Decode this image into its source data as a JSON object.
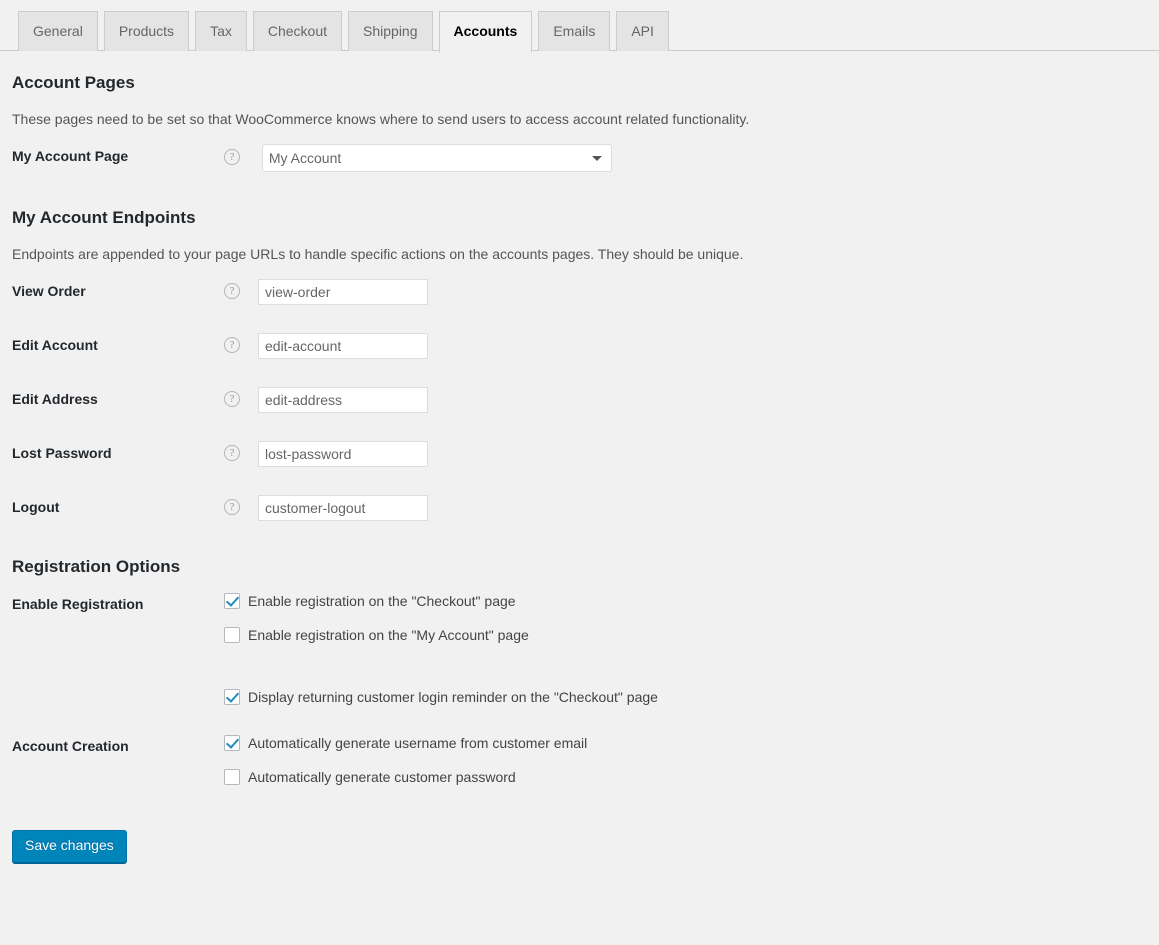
{
  "nav_tabs": [
    {
      "label": "General",
      "active": false
    },
    {
      "label": "Products",
      "active": false
    },
    {
      "label": "Tax",
      "active": false
    },
    {
      "label": "Checkout",
      "active": false
    },
    {
      "label": "Shipping",
      "active": false
    },
    {
      "label": "Accounts",
      "active": true
    },
    {
      "label": "Emails",
      "active": false
    },
    {
      "label": "API",
      "active": false
    }
  ],
  "sections": {
    "account_pages": {
      "title": "Account Pages",
      "description": "These pages need to be set so that WooCommerce knows where to send users to access account related functionality.",
      "my_account_page": {
        "label": "My Account Page",
        "help_icon": "help-circle-icon",
        "selected": "My Account",
        "options": [
          "My Account"
        ]
      }
    },
    "endpoints": {
      "title": "My Account Endpoints",
      "description": "Endpoints are appended to your page URLs to handle specific actions on the accounts pages. They should be unique.",
      "fields": [
        {
          "label": "View Order",
          "value": "view-order",
          "help_icon": "help-circle-icon"
        },
        {
          "label": "Edit Account",
          "value": "edit-account",
          "help_icon": "help-circle-icon"
        },
        {
          "label": "Edit Address",
          "value": "edit-address",
          "help_icon": "help-circle-icon"
        },
        {
          "label": "Lost Password",
          "value": "lost-password",
          "help_icon": "help-circle-icon"
        },
        {
          "label": "Logout",
          "value": "customer-logout",
          "help_icon": "help-circle-icon"
        }
      ]
    },
    "registration": {
      "title": "Registration Options",
      "enable_registration": {
        "label": "Enable Registration",
        "checkboxes": [
          {
            "label": "Enable registration on the \"Checkout\" page",
            "checked": true,
            "spaced": false
          },
          {
            "label": "Enable registration on the \"My Account\" page",
            "checked": false,
            "spaced": false
          },
          {
            "label": "Display returning customer login reminder on the \"Checkout\" page",
            "checked": true,
            "spaced": true
          }
        ]
      },
      "account_creation": {
        "label": "Account Creation",
        "checkboxes": [
          {
            "label": "Automatically generate username from customer email",
            "checked": true,
            "spaced": false
          },
          {
            "label": "Automatically generate customer password",
            "checked": false,
            "spaced": false
          }
        ]
      }
    }
  },
  "submit": {
    "save_label": "Save changes"
  },
  "colors": {
    "page_background": "#f1f1f1",
    "primary_button": "#0085ba",
    "heading_text": "#23282d",
    "checkbox_check": "#1e8cbe",
    "input_border": "#dddddd",
    "tab_inactive_bg": "#e4e4e4"
  }
}
